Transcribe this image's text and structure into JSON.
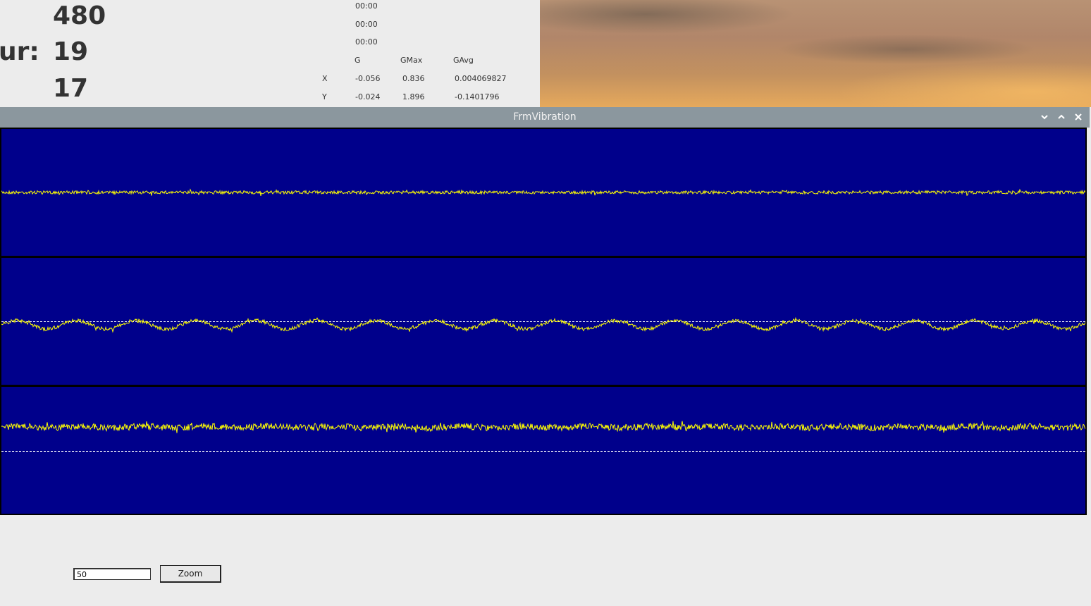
{
  "background_window": {
    "values": [
      "480",
      "19",
      "17"
    ],
    "row_label": "ur:",
    "times": [
      "00:00",
      "00:00",
      "00:00"
    ],
    "table": {
      "headers": [
        "G",
        "GMax",
        "GAvg"
      ],
      "rows": [
        {
          "axis": "X",
          "g": "-0.056",
          "gmax": "0.836",
          "gavg": "0.004069827"
        },
        {
          "axis": "Y",
          "g": "-0.024",
          "gmax": "1.896",
          "gavg": "-0.1401796"
        }
      ]
    }
  },
  "window": {
    "title": "FrmVibration",
    "controls": {
      "minimize_icon": "chevron-down-icon",
      "maximize_icon": "chevron-up-icon",
      "close_icon": "close-icon"
    }
  },
  "graphs": {
    "background_color": "#00008b",
    "trace_color": "#ffff00",
    "reference_color": "#ffffff",
    "channels": [
      {
        "style": "low-noise",
        "reference_line": false
      },
      {
        "style": "wave",
        "reference_line": true
      },
      {
        "style": "high-noise",
        "reference_line": true
      }
    ]
  },
  "zoom": {
    "value": "50",
    "button_label": "Zoom"
  }
}
